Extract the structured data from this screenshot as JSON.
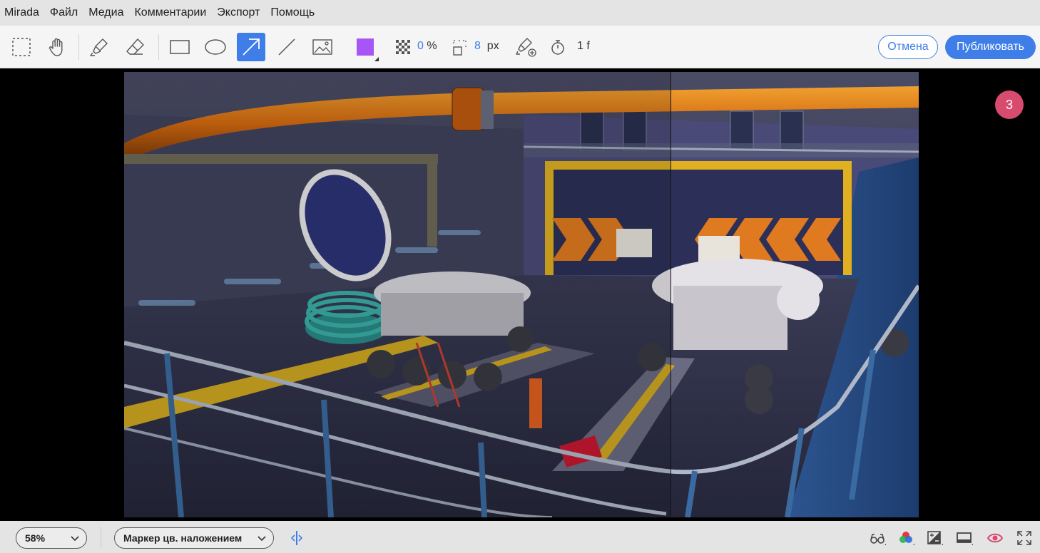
{
  "menu": [
    {
      "id": "mirada",
      "label": "Mirada"
    },
    {
      "id": "file",
      "label": "Файл"
    },
    {
      "id": "media",
      "label": "Медиа"
    },
    {
      "id": "comments",
      "label": "Комментарии"
    },
    {
      "id": "export",
      "label": "Экспорт"
    },
    {
      "id": "help",
      "label": "Помощь"
    }
  ],
  "toolbar": {
    "tools": [
      {
        "name": "marquee-select-icon"
      },
      {
        "name": "hand-pan-icon"
      },
      {
        "name": "highlighter-icon"
      },
      {
        "name": "eraser-icon"
      },
      {
        "name": "rectangle-icon"
      },
      {
        "name": "ellipse-icon"
      },
      {
        "name": "arrow-icon",
        "active": true
      },
      {
        "name": "line-icon"
      },
      {
        "name": "image-icon"
      }
    ],
    "color": "#a855f7",
    "opacity_value": "0",
    "opacity_unit": "%",
    "stroke_value": "8",
    "stroke_unit": "px",
    "duration_value": "1 f",
    "cancel_label": "Отмена",
    "publish_label": "Публиковать"
  },
  "viewer": {
    "annotation_count": "3",
    "wipe_position": 0.688
  },
  "statusbar": {
    "zoom": "58%",
    "mode": "Маркер цв. наложением"
  },
  "colors": {
    "accent": "#3f7ee8",
    "badge": "#d84a6e"
  }
}
